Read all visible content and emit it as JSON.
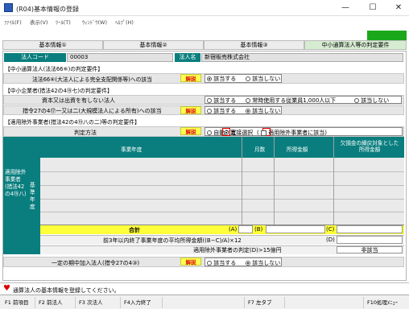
{
  "window": {
    "title": "(R04)基本情報の登録",
    "minimize": "—",
    "maximize": "☐",
    "close": "✕"
  },
  "menu": [
    "ﾌｧｲﾙ(F)",
    "表示(V)",
    "ﾂｰﾙ(T)",
    "ｳｨﾝﾄﾞｳ(W)",
    "ﾍﾙﾌﾟ(H)"
  ],
  "tabs": [
    "基本情報①",
    "基本情報②",
    "基本情報③",
    "中小通算法人等の判定要件"
  ],
  "company": {
    "code_label": "法人コード",
    "code_value": "00003",
    "name_label": "法人名",
    "name_value": "新宿販売株式会社"
  },
  "sec1": {
    "heading": "【中小通算法人(法法66⑥)の判定要件】",
    "row_label": "法法66⑥(大法人による完全支配関係等)への該当",
    "kaisetsu": "解説",
    "opt_yes": "該当する",
    "opt_no": "該当しない"
  },
  "sec2": {
    "heading": "【中小企業者(措法42の4⑲七)の判定要件】",
    "row1_label": "資本又は出資を有しない法人",
    "row1_yes": "該当する",
    "row1_mid": "常時使用する従業員1,000人以下",
    "row1_no": "該当しない",
    "row2_label": "措令27の4⑰一又は二(大規模法人による所有)への該当",
    "row2_kaisetsu": "解説",
    "row2_yes": "該当する",
    "row2_no": "該当しない"
  },
  "sec3": {
    "heading": "【適用除外事業者(措法42の4⑲八の二)等の判定要件】",
    "method_label": "判定方法",
    "kaisetsu": "解説",
    "opt_auto": "自動判定",
    "opt_direct": "直接選択",
    "chk_label": "適用除外事業者に該当",
    "side_label": "適用除外事業者(措法42の4⑲八)",
    "base_year_label": "基準年度",
    "col_year": "事業年度",
    "col_months": "月数",
    "col_income": "所得金額",
    "col_loss": "欠損金の繰戻対象とした所得金額",
    "total_label": "合計",
    "mark_a": "(A)",
    "mark_b": "(B)",
    "mark_c": "(C)",
    "mark_d": "(D)",
    "avg_label": "前3年以内終了事業年度の平均所得金額((B−C)/A)×12",
    "judge_label": "適用除外事業者の判定(D)>15億円",
    "judge_value": "非該当"
  },
  "sec4": {
    "label": "一定の期中加入法人(措令27の4③)",
    "kaisetsu": "解説",
    "opt_yes": "該当する",
    "opt_no": "該当しない"
  },
  "status": {
    "icon": "heart-icon",
    "text": "通算法人の基本情報を登録してください。"
  },
  "fkeys": [
    "F1 前項目",
    "F2 前法人",
    "F3 次法人",
    "F4入力終了",
    "F7 左タブ",
    "F10処理ﾒﾆｭｰ"
  ],
  "colors": {
    "teal": "#0a7e7e",
    "kaisetsu_bg": "#ffff4d",
    "kaisetsu_text": "#dd1111",
    "highlight": "#e00000",
    "green_accent": "#1aa81a"
  }
}
